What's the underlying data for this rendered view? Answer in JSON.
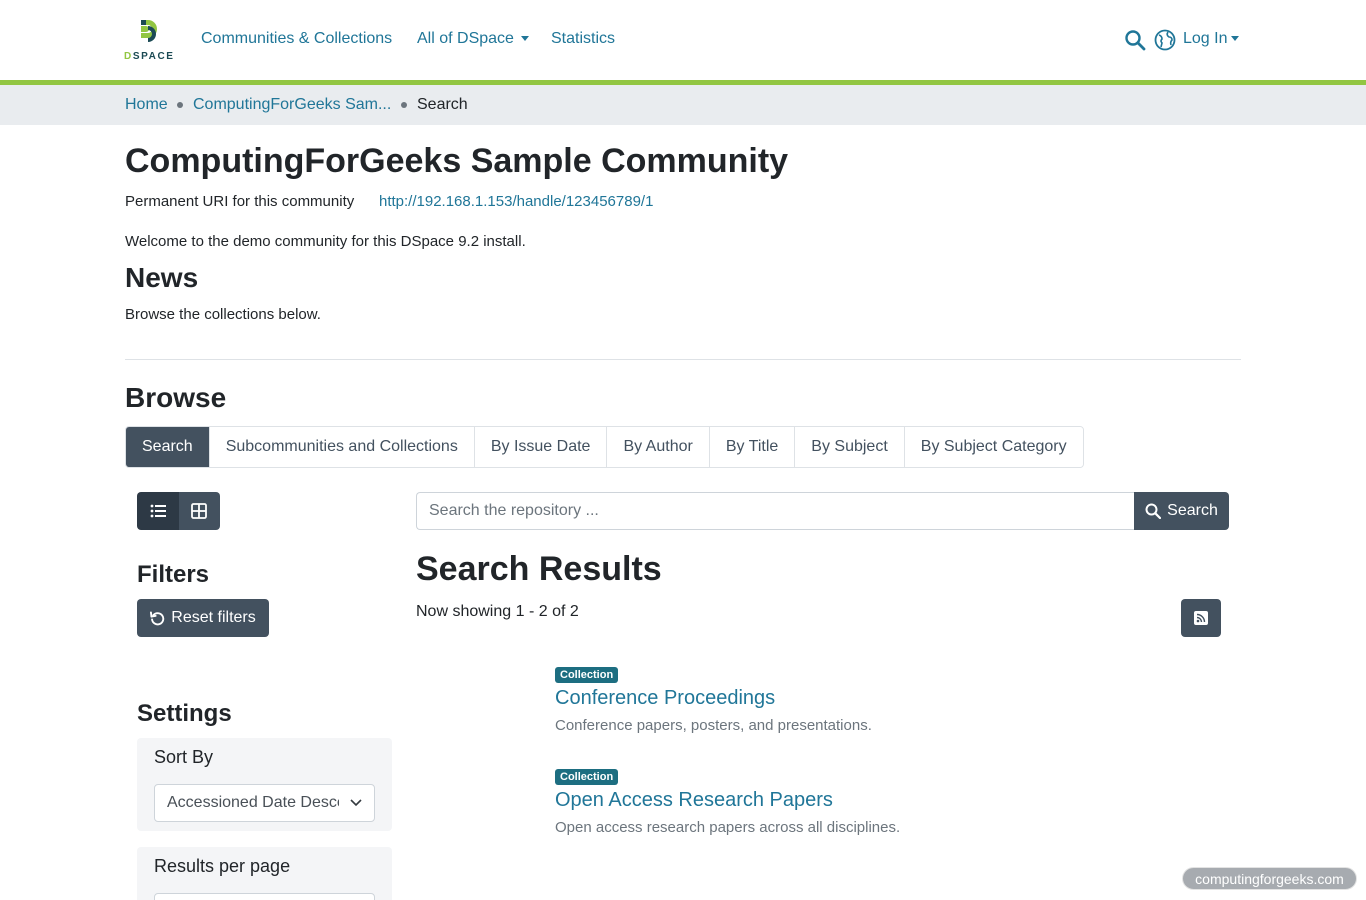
{
  "header": {
    "logo_text": "DSPACE",
    "nav": [
      {
        "label": "Communities & Collections"
      },
      {
        "label": "All of DSpace"
      },
      {
        "label": "Statistics"
      }
    ],
    "login_label": "Log In",
    "icons": [
      "search-icon",
      "globe-icon"
    ],
    "accent_color": "#92c642"
  },
  "breadcrumb": {
    "home": "Home",
    "community": "ComputingForGeeks Sam...",
    "current": "Search"
  },
  "community": {
    "title": "ComputingForGeeks Sample Community",
    "uri_label": "Permanent URI for this community",
    "uri": "http://192.168.1.153/handle/123456789/1",
    "welcome": "Welcome to the demo community for this DSpace 9.2 install.",
    "news_title": "News",
    "news_text": "Browse the collections below."
  },
  "browse": {
    "title": "Browse",
    "tabs": [
      "Search",
      "Subcommunities and Collections",
      "By Issue Date",
      "By Author",
      "By Title",
      "By Subject",
      "By Subject Category"
    ],
    "active_tab": "Search"
  },
  "search": {
    "placeholder": "Search the repository ...",
    "button_label": "Search"
  },
  "sidebar": {
    "filters_title": "Filters",
    "reset_label": "Reset filters",
    "settings_title": "Settings",
    "sort_by_label": "Sort By",
    "sort_by_value": "Accessioned Date Descending",
    "results_per_page_label": "Results per page"
  },
  "results": {
    "title": "Search Results",
    "count_text": "Now showing 1 - 2 of 2",
    "items": [
      {
        "badge": "Collection",
        "title": "Conference Proceedings",
        "description": "Conference papers, posters, and presentations."
      },
      {
        "badge": "Collection",
        "title": "Open Access Research Papers",
        "description": "Open access research papers across all disciplines."
      }
    ]
  },
  "watermark": "computingforgeeks.com"
}
